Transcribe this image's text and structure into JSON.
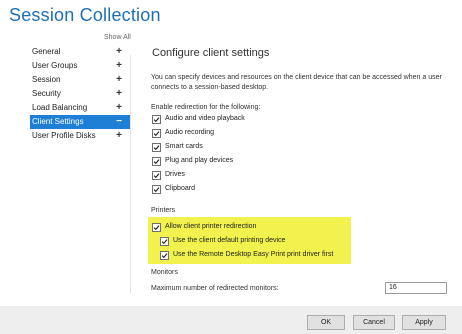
{
  "window": {
    "title": "Session Collection"
  },
  "nav": {
    "show_all": "Show All",
    "items": [
      {
        "label": "General",
        "sign": "+"
      },
      {
        "label": "User Groups",
        "sign": "+"
      },
      {
        "label": "Session",
        "sign": "+"
      },
      {
        "label": "Security",
        "sign": "+"
      },
      {
        "label": "Load Balancing",
        "sign": "+"
      },
      {
        "label": "Client Settings",
        "sign": "−",
        "selected": true
      },
      {
        "label": "User Profile Disks",
        "sign": "+"
      }
    ]
  },
  "main": {
    "title": "Configure client settings",
    "intro": "You can specify devices and resources on the client device that can be accessed when a user connects to a session-based desktop.",
    "redirection_label": "Enable redirection for the following:",
    "redirection_items": [
      {
        "label": "Audio and video playback",
        "checked": true
      },
      {
        "label": "Audio recording",
        "checked": true
      },
      {
        "label": "Smart cards",
        "checked": true
      },
      {
        "label": "Plug and play devices",
        "checked": true
      },
      {
        "label": "Drives",
        "checked": true
      },
      {
        "label": "Clipboard",
        "checked": true
      }
    ],
    "printers_label": "Printers",
    "printer_items": [
      {
        "label": "Allow client printer redirection",
        "checked": true
      },
      {
        "label": "Use the client default printing device",
        "checked": true
      },
      {
        "label": "Use the Remote Desktop Easy Print print driver first",
        "checked": true
      }
    ],
    "monitors_label": "Monitors",
    "max_monitors_label": "Maximum number of redirected monitors:",
    "max_monitors_value": "16",
    "highlight_color": "#f1f24e"
  },
  "footer": {
    "ok_label": "OK",
    "cancel_label": "Cancel",
    "apply_label": "Apply"
  },
  "colors": {
    "title": "#1e6fb3",
    "selected_nav_bg": "#1f7fd6"
  }
}
